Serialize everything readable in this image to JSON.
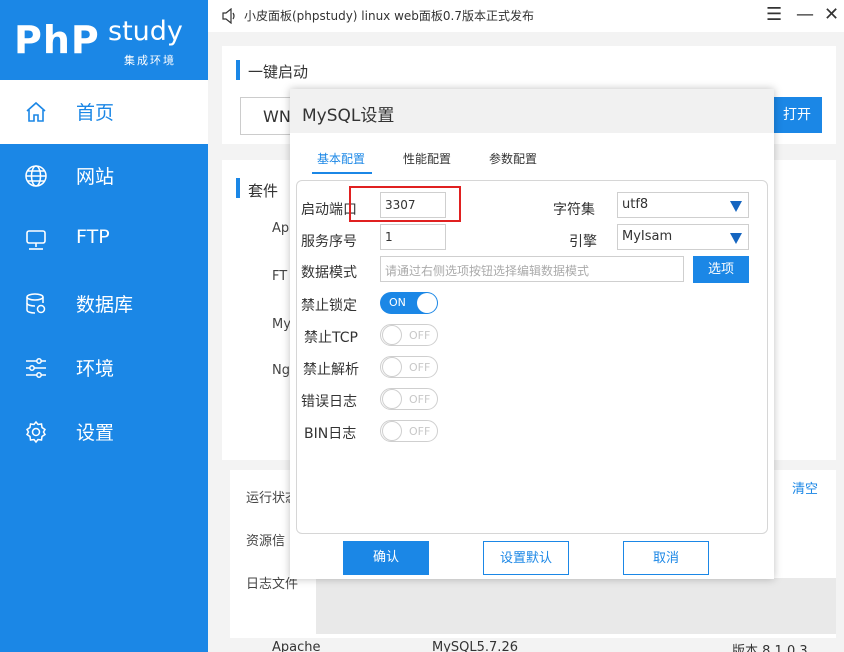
{
  "sidebar": {
    "logo_php": "PhP",
    "logo_study": "study",
    "logo_sub": "集成环境",
    "items": [
      {
        "label": "首页",
        "icon": "home-icon"
      },
      {
        "label": "网站",
        "icon": "globe-icon"
      },
      {
        "label": "FTP",
        "icon": "monitor-icon"
      },
      {
        "label": "数据库",
        "icon": "database-icon"
      },
      {
        "label": "环境",
        "icon": "sliders-icon"
      },
      {
        "label": "设置",
        "icon": "gear-icon"
      }
    ]
  },
  "titlebar": {
    "title": "小皮面板(phpstudy) linux web面板0.7版本正式发布",
    "menu": "☰",
    "minimize": "—",
    "close": "✕"
  },
  "main": {
    "section_quickstart": "一键启动",
    "wnmp": "WN",
    "open_button": "打开",
    "section_suite": "套件",
    "suite_labels": [
      "Ap",
      "FT",
      "My",
      "Ng"
    ],
    "status_label": "运行状态",
    "resource_label": "资源信",
    "log_label": "日志文件",
    "clear_link": "清空",
    "bottom_left": "Apache",
    "bottom_mid": "MySQL5.7.26",
    "bottom_right": "版本 8.1.0.3"
  },
  "dialog": {
    "title": "MySQL设置",
    "tabs": [
      "基本配置",
      "性能配置",
      "参数配置"
    ],
    "fields": {
      "port_label": "启动端口",
      "port_value": "3307",
      "charset_label": "字符集",
      "charset_value": "utf8",
      "service_label": "服务序号",
      "service_value": "1",
      "engine_label": "引擎",
      "engine_value": "MyIsam",
      "mode_label": "数据模式",
      "mode_placeholder": "请通过右侧选项按钮选择编辑数据模式",
      "choose_button": "选项"
    },
    "toggles": [
      {
        "label": "禁止锁定",
        "state": "ON"
      },
      {
        "label": "禁止TCP",
        "state": "OFF"
      },
      {
        "label": "禁止解析",
        "state": "OFF"
      },
      {
        "label": "错误日志",
        "state": "OFF"
      },
      {
        "label": "BIN日志",
        "state": "OFF"
      }
    ],
    "buttons": {
      "confirm": "确认",
      "defaults": "设置默认",
      "cancel": "取消"
    }
  },
  "colors": {
    "accent": "#1b87e6",
    "highlight": "#e02020"
  }
}
